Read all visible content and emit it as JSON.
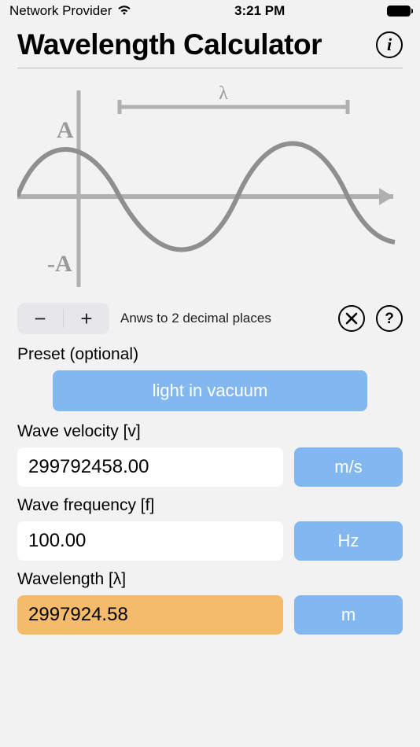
{
  "statusBar": {
    "provider": "Network Provider",
    "time": "3:21 PM"
  },
  "header": {
    "title": "Wavelength Calculator"
  },
  "diagram": {
    "amplitudePos": "A",
    "amplitudeNeg": "-A",
    "wavelengthSymbol": "λ"
  },
  "controls": {
    "decimalHint": "Anws to 2 decimal places"
  },
  "preset": {
    "label": "Preset (optional)",
    "value": "light in vacuum"
  },
  "fields": {
    "velocity": {
      "label": "Wave velocity [v]",
      "value": "299792458.00",
      "unit": "m/s"
    },
    "frequency": {
      "label": "Wave frequency [f]",
      "value": "100.00",
      "unit": "Hz"
    },
    "wavelength": {
      "label": "Wavelength [λ]",
      "value": "2997924.58",
      "unit": "m"
    }
  }
}
